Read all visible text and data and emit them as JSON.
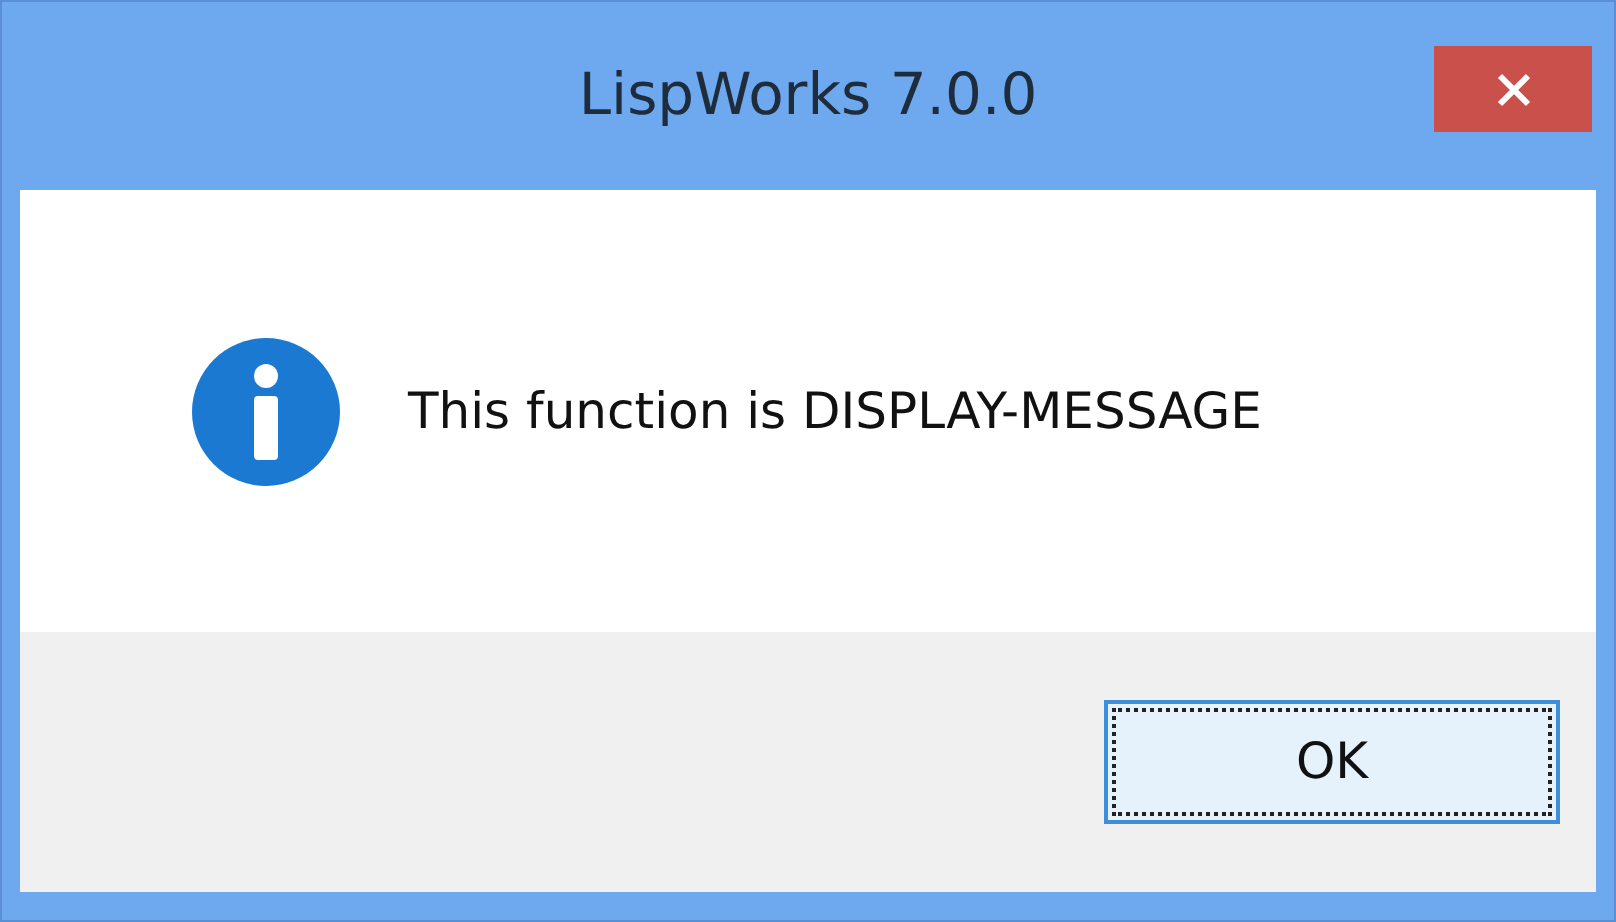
{
  "window": {
    "title": "LispWorks 7.0.0"
  },
  "message": {
    "kind": "info",
    "text": "This function is DISPLAY-MESSAGE"
  },
  "buttons": [
    {
      "label": "OK",
      "focused": true
    }
  ]
}
